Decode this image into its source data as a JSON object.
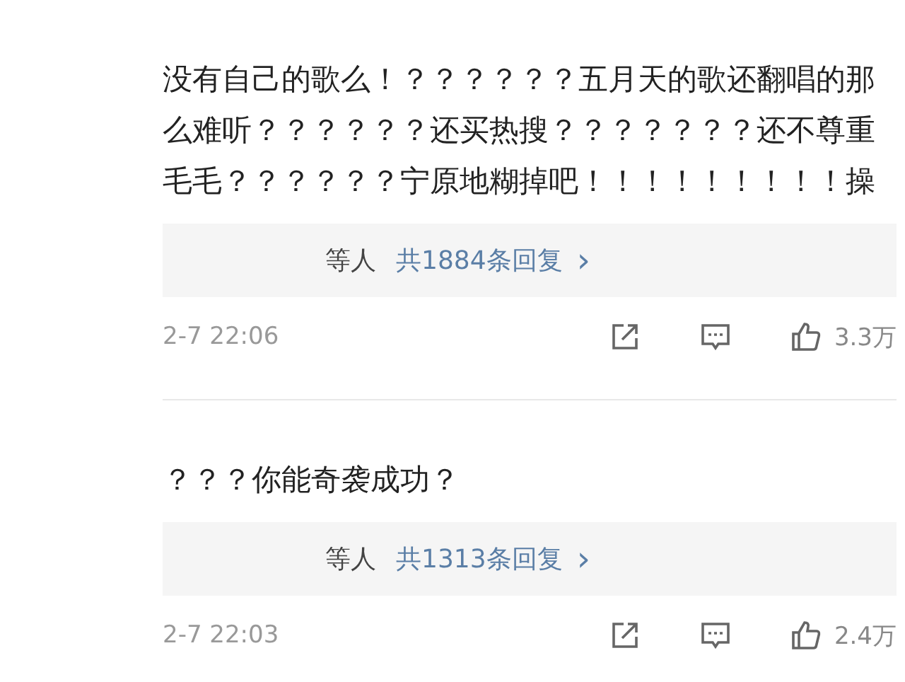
{
  "comments": [
    {
      "text": "没有自己的歌么！？？？？？？五月天的歌还翻唱的那么难听？？？？？？还买热搜？？？？？？？还不尊重毛毛？？？？？？宁原地糊掉吧！！！！！！！！！操",
      "replies": {
        "names_suffix": "等人",
        "count_link": "共1884条回复",
        "chevron": "›"
      },
      "time": "2-7 22:06",
      "likes": "3.3万"
    },
    {
      "text": "？？？你能奇袭成功？",
      "replies": {
        "names_suffix": "等人",
        "count_link": "共1313条回复",
        "chevron": "›"
      },
      "time": "2-7 22:03",
      "likes": "2.4万"
    }
  ]
}
